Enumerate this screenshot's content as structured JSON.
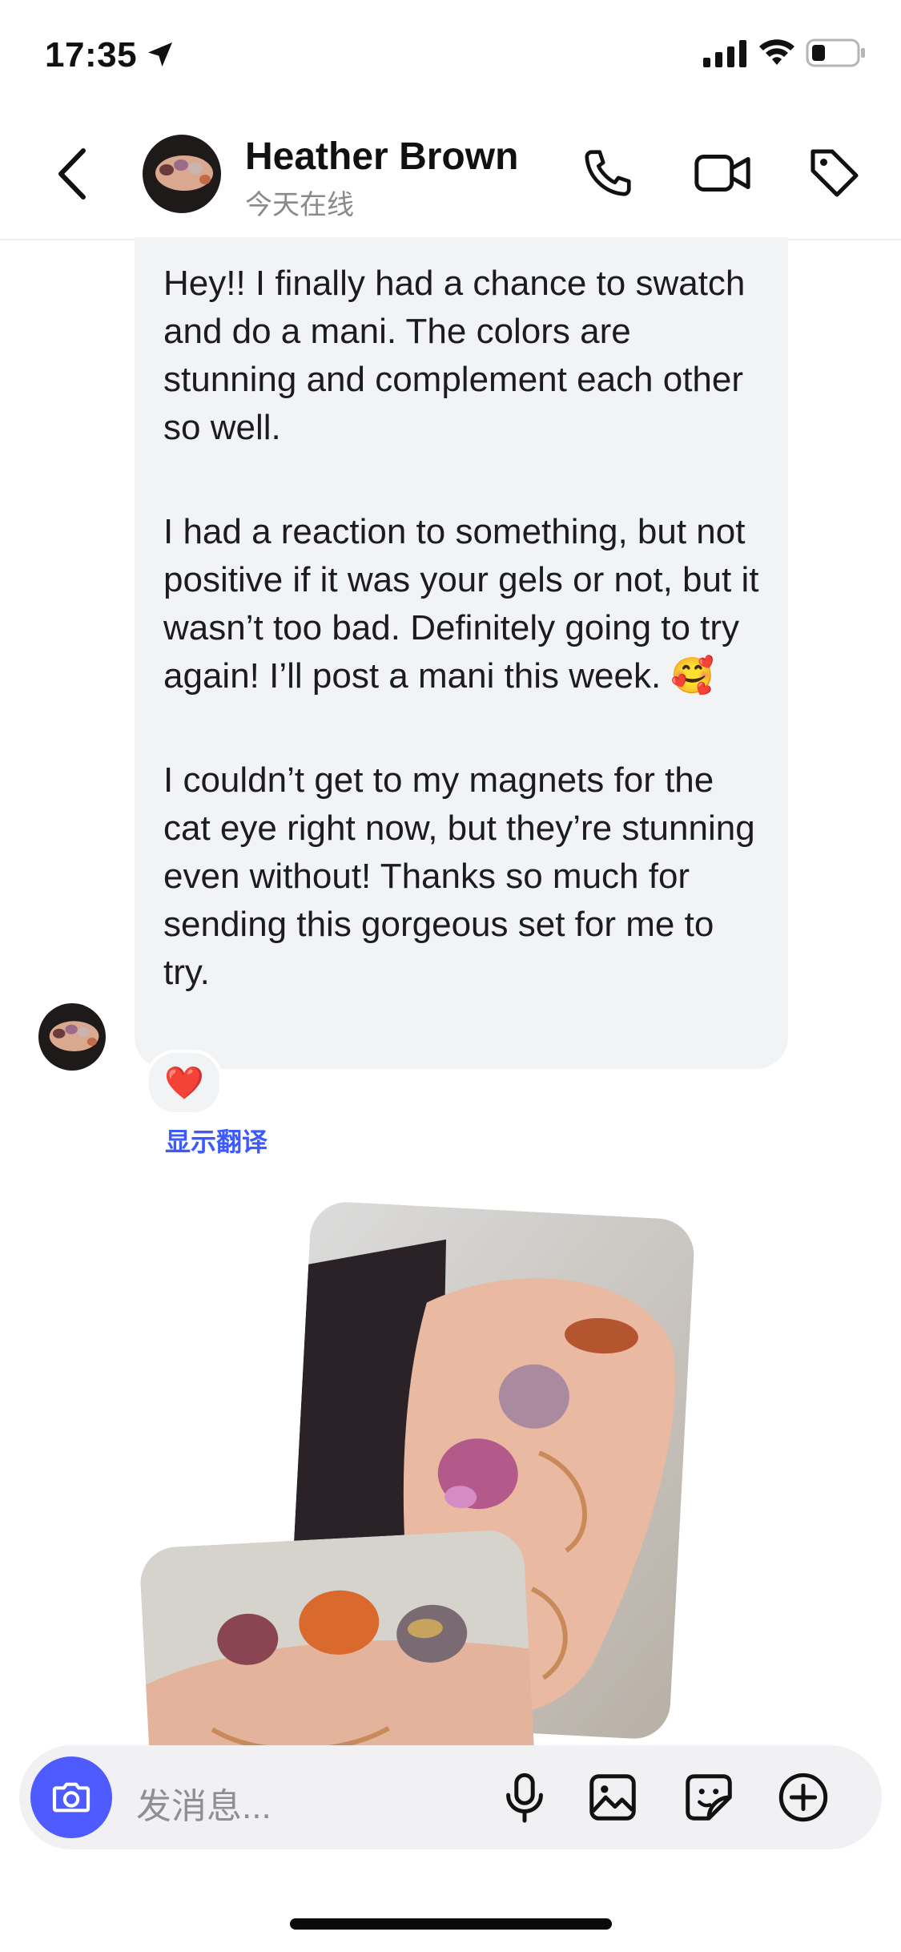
{
  "status_bar": {
    "time": "17:35"
  },
  "header": {
    "contact_name": "Heather Brown",
    "presence": "今天在线"
  },
  "message": {
    "paragraphs": [
      "Hey!! I finally had a chance to swatch and do a mani. The colors are stunning and complement each other so well.",
      "I had a reaction to something, but not positive if it was your gels or not, but it wasn’t too bad. Definitely going to try again! I’ll post a mani this week. 🥰",
      "I couldn’t get to my magnets for the cat eye right now, but they’re stunning even without! Thanks so much for sending this gorgeous set for me to try."
    ],
    "reaction": "❤️",
    "translate_link": "显示翻译"
  },
  "composer": {
    "placeholder": "发消息..."
  },
  "colors": {
    "accent": "#4E5BFF",
    "link": "#3D5AFE",
    "bubble": "#F2F3F5"
  },
  "icons": [
    "location-arrow-icon",
    "signal-icon",
    "wifi-icon",
    "battery-icon",
    "back-chevron-icon",
    "phone-icon",
    "video-icon",
    "tag-icon",
    "camera-icon",
    "mic-icon",
    "image-icon",
    "sticker-icon",
    "plus-icon"
  ]
}
